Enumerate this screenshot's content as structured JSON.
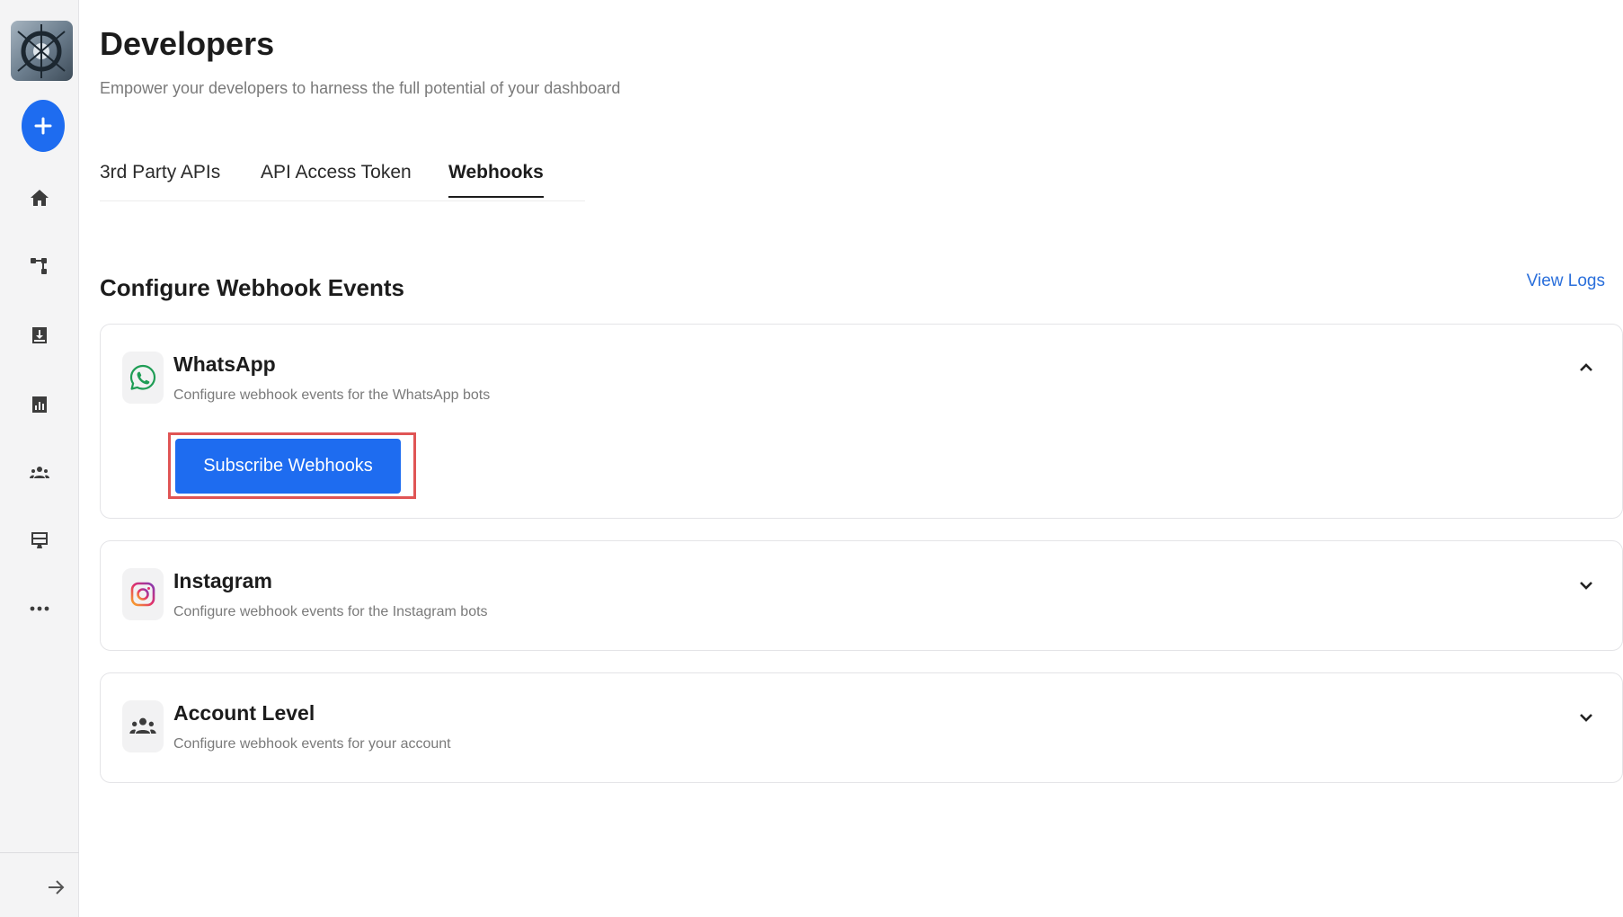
{
  "sidebar": {
    "logo_icon": "brand-logo",
    "add_icon": "plus-icon",
    "items": [
      {
        "name": "home-icon"
      },
      {
        "name": "flow-icon"
      },
      {
        "name": "inbox-icon"
      },
      {
        "name": "analytics-icon"
      },
      {
        "name": "contacts-icon"
      },
      {
        "name": "broadcast-icon"
      },
      {
        "name": "more-icon"
      }
    ],
    "collapse_icon": "arrow-right-icon"
  },
  "header": {
    "title": "Developers",
    "subtitle": "Empower your developers to harness the full potential of your dashboard"
  },
  "tabs": [
    {
      "label": "3rd Party APIs",
      "active": false
    },
    {
      "label": "API Access Token",
      "active": false
    },
    {
      "label": "Webhooks",
      "active": true
    }
  ],
  "section": {
    "title": "Configure Webhook Events",
    "view_logs": "View Logs"
  },
  "cards": [
    {
      "title": "WhatsApp",
      "description": "Configure webhook events for the WhatsApp bots",
      "icon": "whatsapp-icon",
      "expanded": true,
      "button_label": "Subscribe Webhooks"
    },
    {
      "title": "Instagram",
      "description": "Configure webhook events for the Instagram bots",
      "icon": "instagram-icon",
      "expanded": false
    },
    {
      "title": "Account Level",
      "description": "Configure webhook events for your account",
      "icon": "users-icon",
      "expanded": false
    }
  ],
  "colors": {
    "accent": "#1e6cf0",
    "highlight": "#e05555",
    "link": "#2a6fdb"
  }
}
